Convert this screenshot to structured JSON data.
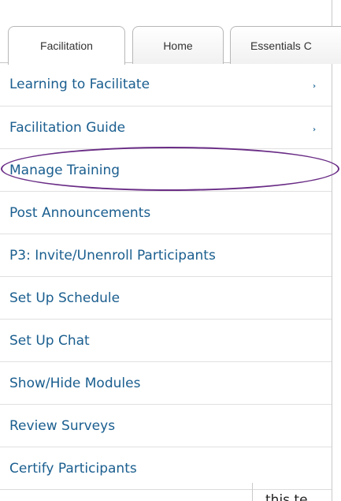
{
  "tabs": [
    {
      "label": "Facilitation",
      "active": true
    },
    {
      "label": "Home",
      "active": false
    },
    {
      "label": "Essentials C",
      "active": false
    }
  ],
  "menu": {
    "items": [
      {
        "label": "Learning to Facilitate",
        "has_submenu": true
      },
      {
        "label": "Facilitation Guide",
        "has_submenu": true
      },
      {
        "label": "Manage Training",
        "has_submenu": false,
        "highlighted": true
      },
      {
        "label": "Post Announcements",
        "has_submenu": false
      },
      {
        "label": "P3: Invite/Unenroll Participants",
        "has_submenu": false
      },
      {
        "label": "Set Up Schedule",
        "has_submenu": false
      },
      {
        "label": "Set Up Chat",
        "has_submenu": false
      },
      {
        "label": "Show/Hide Modules",
        "has_submenu": false
      },
      {
        "label": "Review Surveys",
        "has_submenu": false
      },
      {
        "label": "Certify Participants",
        "has_submenu": false
      }
    ],
    "submenu_glyph": "›"
  },
  "background_text": "this te",
  "colors": {
    "link": "#1a5e8f",
    "highlight": "#6a2d86",
    "border": "#c6c6c6"
  },
  "icons": {
    "submenu": "chevron-right-icon"
  }
}
